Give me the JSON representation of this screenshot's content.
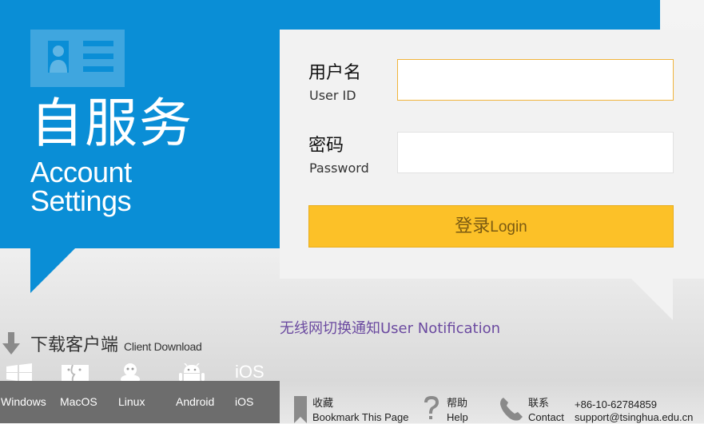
{
  "brand": {
    "title_cn": "自服务",
    "title_en_line1": "Account",
    "title_en_line2": "Settings",
    "card_icon": "id-card-icon"
  },
  "login": {
    "username_label_cn": "用户名",
    "username_label_en": "User ID",
    "username_value": "",
    "password_label_cn": "密码",
    "password_label_en": "Password",
    "password_value": "",
    "button_cn": "登录",
    "button_en": "Login"
  },
  "notice": {
    "link_text": "无线网切换通知User  Notification"
  },
  "client_download": {
    "title_cn": "下载客户端",
    "title_en": "Client Download",
    "platforms": [
      {
        "label": "Windows",
        "icon": "windows-icon"
      },
      {
        "label": "MacOS",
        "icon": "macos-icon"
      },
      {
        "label": "Linux",
        "icon": "linux-icon"
      },
      {
        "label": "Android",
        "icon": "android-icon"
      },
      {
        "label": "iOS",
        "icon": "ios-icon"
      }
    ],
    "ios_icon_text": "iOS"
  },
  "footer": {
    "bookmark_cn": "收藏",
    "bookmark_en": "Bookmark This Page",
    "help_cn": "帮助",
    "help_en": "Help",
    "contact_cn": "联系",
    "contact_en": "Contact",
    "phone": "+86-10-62784859",
    "email": "support@tsinghua.edu.cn"
  },
  "colors": {
    "brand_blue": "#0a8ed6",
    "button_yellow": "#fcc128",
    "link_purple": "#6b4aa0",
    "os_bar": "#6d6d6d"
  }
}
